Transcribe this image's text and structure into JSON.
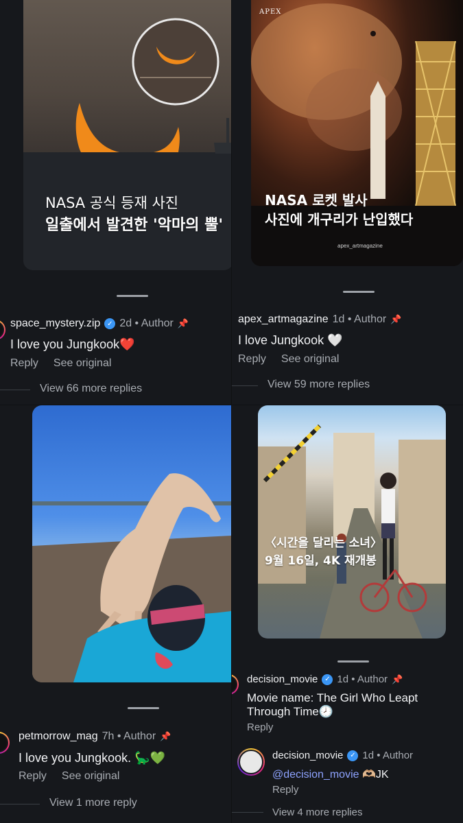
{
  "top_left": {
    "image_caption_line1": "NASA 공식 등재 사진",
    "image_caption_line2": "일출에서 발견한 '악마의 뿔'",
    "comment": {
      "handle": "space_mystery.zip",
      "meta": "2d • Author",
      "text": "I love you Jungkook❤️",
      "reply_label": "Reply",
      "see_original_label": "See original",
      "view_more": "View 66 more replies"
    }
  },
  "top_right": {
    "brand": "APEX",
    "image_caption_line1": "NASA 로켓 발사",
    "image_caption_line2": "사진에 개구리가 난입했다",
    "watermark": "apex_artmagazine",
    "comment": {
      "handle": "apex_artmagazine",
      "meta": "1d • Author",
      "text": "I love Jungkook 🤍",
      "reply_label": "Reply",
      "see_original_label": "See original",
      "view_more": "View 59 more replies"
    }
  },
  "bottom_left": {
    "comment": {
      "handle": "petmorrow_mag",
      "meta": "7h • Author",
      "text": "I love you Jungkook. 🦕💚",
      "reply_label": "Reply",
      "see_original_label": "See original",
      "view_more": "View 1 more reply"
    }
  },
  "bottom_right": {
    "image_caption_line1": "〈시간을 달리는 소녀〉",
    "image_caption_line2": "9월 16일, 4K 재개봉",
    "comment": {
      "handle": "decision_movie",
      "meta": "1d • Author",
      "text_line1": "Movie name: The Girl Who Leapt",
      "text_line2": "Through Time🕗",
      "reply_label": "Reply"
    },
    "reply": {
      "handle": "decision_movie",
      "meta": "1d • Author",
      "mention": "@decision_movie",
      "text": " 🫶🏼JK",
      "reply_label": "Reply",
      "view_more": "View 4 more replies"
    }
  },
  "colors": {
    "verified": "#3b96f5",
    "accent_link": "#8ea3ff",
    "muted": "#a9adb3"
  }
}
